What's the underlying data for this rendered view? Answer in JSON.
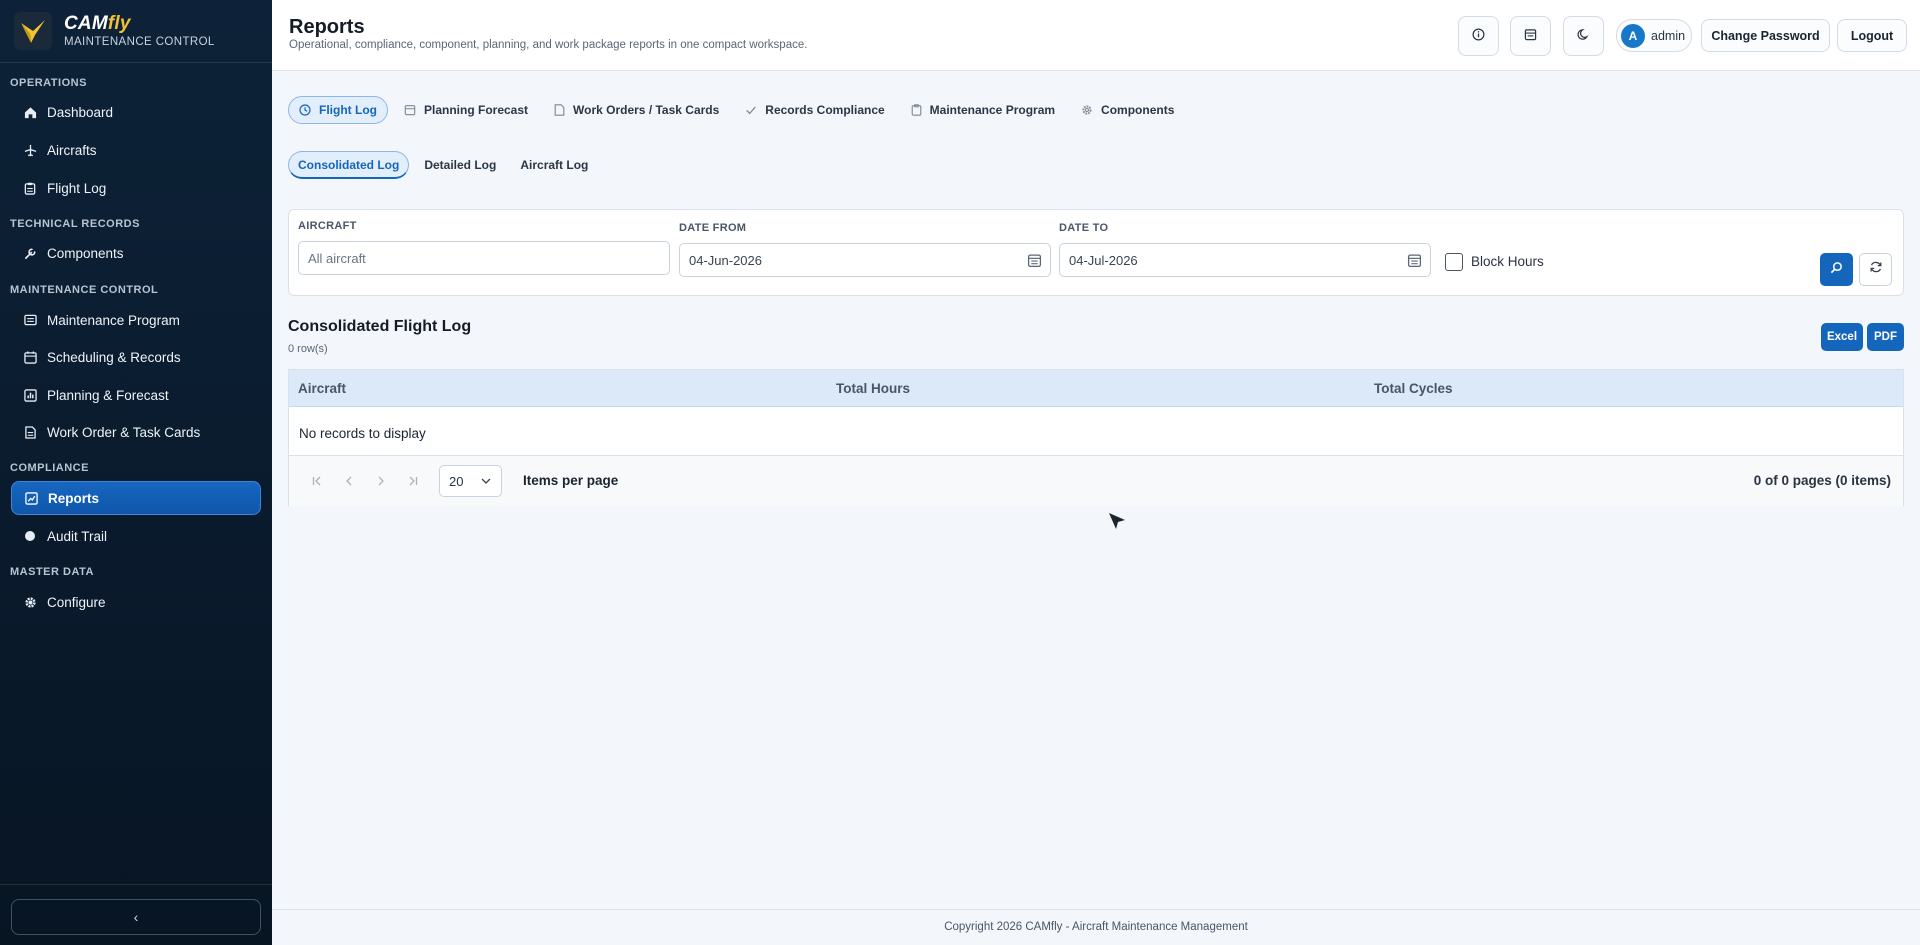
{
  "brand": {
    "name_main": "CAM",
    "name_accent": "fly",
    "subtitle": "MAINTENANCE CONTROL"
  },
  "sidebar": {
    "sections": [
      {
        "title": "OPERATIONS"
      },
      {
        "title": "TECHNICAL RECORDS"
      },
      {
        "title": "MAINTENANCE CONTROL"
      },
      {
        "title": "COMPLIANCE"
      },
      {
        "title": "MASTER DATA"
      }
    ],
    "items": [
      {
        "label": "Dashboard",
        "icon": "home-icon"
      },
      {
        "label": "Aircrafts",
        "icon": "plane-icon"
      },
      {
        "label": "Flight Log",
        "icon": "clipboard-icon"
      },
      {
        "label": "Components",
        "icon": "wrench-icon"
      },
      {
        "label": "Maintenance Program",
        "icon": "list-icon"
      },
      {
        "label": "Scheduling & Records",
        "icon": "calendar-icon"
      },
      {
        "label": "Planning & Forecast",
        "icon": "chart-icon"
      },
      {
        "label": "Work Order & Task Cards",
        "icon": "document-icon"
      },
      {
        "label": "Reports",
        "icon": "report-icon",
        "active": true
      },
      {
        "label": "Audit Trail",
        "icon": "circle-icon"
      },
      {
        "label": "Configure",
        "icon": "gear-icon"
      }
    ],
    "collapse_glyph": "‹"
  },
  "header": {
    "title": "Reports",
    "subtitle": "Operational, compliance, component, planning, and work package reports in one compact workspace.",
    "user_initial": "A",
    "user_name": "admin",
    "change_password": "Change Password",
    "logout": "Logout"
  },
  "tabs": [
    {
      "label": "Flight Log",
      "icon": "clock-icon",
      "active": true
    },
    {
      "label": "Planning Forecast",
      "icon": "calendar-icon"
    },
    {
      "label": "Work Orders / Task Cards",
      "icon": "document-icon"
    },
    {
      "label": "Records Compliance",
      "icon": "check-icon"
    },
    {
      "label": "Maintenance Program",
      "icon": "clipboard-icon"
    },
    {
      "label": "Components",
      "icon": "gear-icon"
    }
  ],
  "subtabs": [
    {
      "label": "Consolidated Log",
      "active": true
    },
    {
      "label": "Detailed Log"
    },
    {
      "label": "Aircraft Log"
    }
  ],
  "filters": {
    "aircraft_label": "AIRCRAFT",
    "aircraft_placeholder": "All aircraft",
    "date_from_label": "DATE FROM",
    "date_from_value": "04-Jun-2026",
    "date_to_label": "DATE TO",
    "date_to_value": "04-Jul-2026",
    "block_hours_label": "Block Hours",
    "block_hours_checked": false
  },
  "grid": {
    "title": "Consolidated Flight Log",
    "row_count": "0 row(s)",
    "export_excel": "Excel",
    "export_pdf": "PDF",
    "columns": [
      "Aircraft",
      "Total Hours",
      "Total Cycles"
    ],
    "empty_text": "No records to display",
    "page_size": "20",
    "items_per_page_label": "Items per page",
    "page_info": "0 of 0 pages (0 items)"
  },
  "footer": {
    "text": "Copyright 2026 CAMfly - Aircraft Maintenance Management"
  },
  "colors": {
    "accent": "#1466bd",
    "sidebar_bg": "#0d2238",
    "brand_yellow": "#f2c230"
  }
}
